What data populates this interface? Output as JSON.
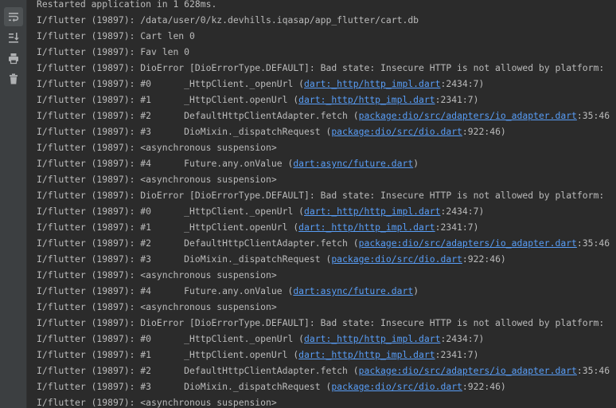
{
  "toolbar": {
    "buttons": [
      {
        "name": "soft-wrap-icon",
        "active": true
      },
      {
        "name": "scroll-to-end-icon",
        "active": false
      },
      {
        "name": "print-icon",
        "active": false
      },
      {
        "name": "trash-icon",
        "active": false
      }
    ]
  },
  "colors": {
    "background": "#2b2b2b",
    "sidebar": "#3c3f41",
    "text": "#bbbbbb",
    "link": "#589df6"
  },
  "console": {
    "lines": [
      [
        {
          "t": "Restarted application in 1 628ms."
        }
      ],
      [
        {
          "t": "I/flutter (19897): /data/user/0/kz.devhills.iqasap/app_flutter/cart.db"
        }
      ],
      [
        {
          "t": "I/flutter (19897): Cart len 0"
        }
      ],
      [
        {
          "t": "I/flutter (19897): Fav len 0"
        }
      ],
      [
        {
          "t": "I/flutter (19897): DioError [DioErrorType.DEFAULT]: Bad state: Insecure HTTP is not allowed by platform:"
        }
      ],
      [
        {
          "t": "I/flutter (19897): #0      _HttpClient._openUrl ("
        },
        {
          "t": "dart:_http/http_impl.dart",
          "link": true
        },
        {
          "t": ":2434:7)"
        }
      ],
      [
        {
          "t": "I/flutter (19897): #1      _HttpClient.openUrl ("
        },
        {
          "t": "dart:_http/http_impl.dart",
          "link": true
        },
        {
          "t": ":2341:7)"
        }
      ],
      [
        {
          "t": "I/flutter (19897): #2      DefaultHttpClientAdapter.fetch ("
        },
        {
          "t": "package:dio/src/adapters/io_adapter.dart",
          "link": true
        },
        {
          "t": ":35:46"
        }
      ],
      [
        {
          "t": "I/flutter (19897): #3      DioMixin._dispatchRequest ("
        },
        {
          "t": "package:dio/src/dio.dart",
          "link": true
        },
        {
          "t": ":922:46)"
        }
      ],
      [
        {
          "t": "I/flutter (19897): <asynchronous suspension>"
        }
      ],
      [
        {
          "t": "I/flutter (19897): #4      Future.any.onValue ("
        },
        {
          "t": "dart:async/future.dart",
          "link": true
        },
        {
          "t": ")"
        }
      ],
      [
        {
          "t": "I/flutter (19897): <asynchronous suspension>"
        }
      ],
      [
        {
          "t": "I/flutter (19897): DioError [DioErrorType.DEFAULT]: Bad state: Insecure HTTP is not allowed by platform:"
        }
      ],
      [
        {
          "t": "I/flutter (19897): #0      _HttpClient._openUrl ("
        },
        {
          "t": "dart:_http/http_impl.dart",
          "link": true
        },
        {
          "t": ":2434:7)"
        }
      ],
      [
        {
          "t": "I/flutter (19897): #1      _HttpClient.openUrl ("
        },
        {
          "t": "dart:_http/http_impl.dart",
          "link": true
        },
        {
          "t": ":2341:7)"
        }
      ],
      [
        {
          "t": "I/flutter (19897): #2      DefaultHttpClientAdapter.fetch ("
        },
        {
          "t": "package:dio/src/adapters/io_adapter.dart",
          "link": true
        },
        {
          "t": ":35:46"
        }
      ],
      [
        {
          "t": "I/flutter (19897): #3      DioMixin._dispatchRequest ("
        },
        {
          "t": "package:dio/src/dio.dart",
          "link": true
        },
        {
          "t": ":922:46)"
        }
      ],
      [
        {
          "t": "I/flutter (19897): <asynchronous suspension>"
        }
      ],
      [
        {
          "t": "I/flutter (19897): #4      Future.any.onValue ("
        },
        {
          "t": "dart:async/future.dart",
          "link": true
        },
        {
          "t": ")"
        }
      ],
      [
        {
          "t": "I/flutter (19897): <asynchronous suspension>"
        }
      ],
      [
        {
          "t": "I/flutter (19897): DioError [DioErrorType.DEFAULT]: Bad state: Insecure HTTP is not allowed by platform:"
        }
      ],
      [
        {
          "t": "I/flutter (19897): #0      _HttpClient._openUrl ("
        },
        {
          "t": "dart:_http/http_impl.dart",
          "link": true
        },
        {
          "t": ":2434:7)"
        }
      ],
      [
        {
          "t": "I/flutter (19897): #1      _HttpClient.openUrl ("
        },
        {
          "t": "dart:_http/http_impl.dart",
          "link": true
        },
        {
          "t": ":2341:7)"
        }
      ],
      [
        {
          "t": "I/flutter (19897): #2      DefaultHttpClientAdapter.fetch ("
        },
        {
          "t": "package:dio/src/adapters/io_adapter.dart",
          "link": true
        },
        {
          "t": ":35:46"
        }
      ],
      [
        {
          "t": "I/flutter (19897): #3      DioMixin._dispatchRequest ("
        },
        {
          "t": "package:dio/src/dio.dart",
          "link": true
        },
        {
          "t": ":922:46)"
        }
      ],
      [
        {
          "t": "I/flutter (19897): <asynchronous suspension>"
        }
      ]
    ]
  }
}
